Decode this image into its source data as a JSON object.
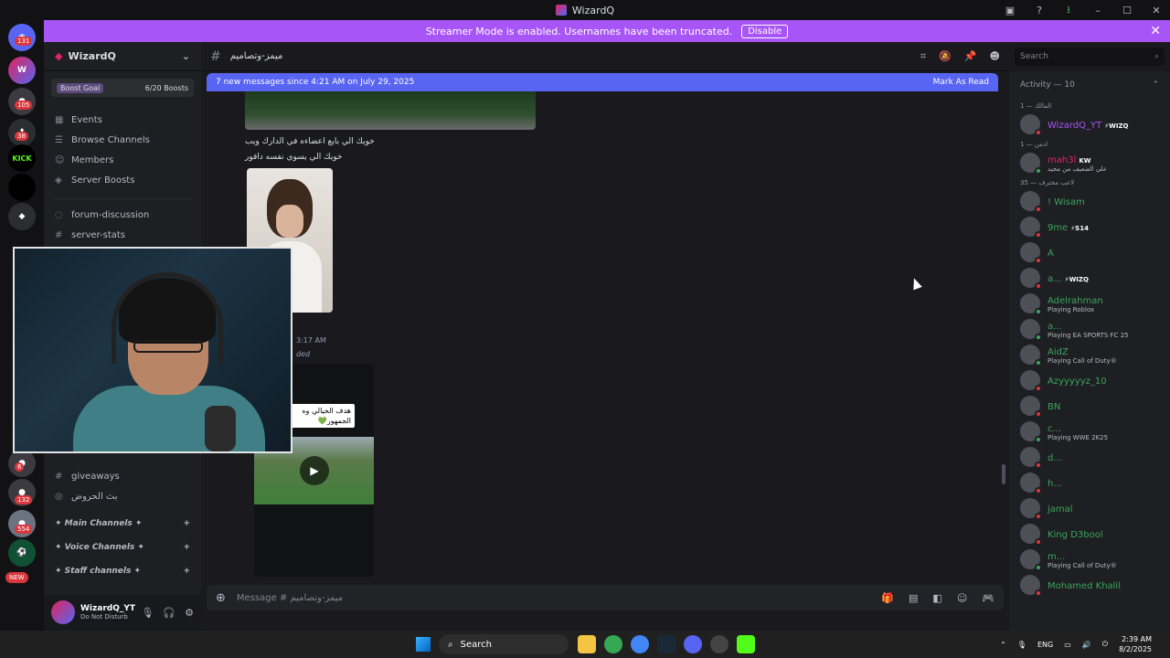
{
  "window": {
    "title": "WizardQ"
  },
  "banner": {
    "text": "Streamer Mode is enabled. Usernames have been truncated.",
    "button": "Disable"
  },
  "servers": {
    "badges": [
      "131",
      "105",
      "38",
      "6",
      "132",
      "554"
    ],
    "kick_label": "KICK",
    "new_label": "NEW"
  },
  "guild": {
    "name": "WizardQ",
    "boost_goal": "Boost Goal",
    "boosts": "6/20 Boosts"
  },
  "nav": {
    "events": "Events",
    "browse": "Browse Channels",
    "members": "Members",
    "boosts": "Server Boosts",
    "forum": "forum-discussion",
    "stats": "server-stats",
    "giveaways": "giveaways",
    "stream": "بث الحروض"
  },
  "categories": [
    "✦ Main Channels ✦",
    "✦ Voice Channels ✦",
    "✦ Staff channels ✦"
  ],
  "user": {
    "name": "WizardQ_YT",
    "status": "Do Not Disturb"
  },
  "channel": {
    "name": "ميمز-وتصاميم"
  },
  "search": {
    "placeholder": "Search"
  },
  "new_messages": {
    "text": "7 new messages since 4:21 AM on July 29, 2025",
    "action": "Mark As Read"
  },
  "chat": {
    "line1": "خويك الي بايع اعضاءه في الدارك ويب",
    "line2": "خويك الي يسوي نفسه دافور",
    "time": "3:17 AM",
    "edited": "ded",
    "video_caption": "هدف الخيالي وه الجمهور💚"
  },
  "composer": {
    "placeholder": "Message # ميمز-وتصاميم"
  },
  "members": {
    "activity": "Activity — 10",
    "groups": [
      "المالك — 1",
      "ادمن — 1",
      "لاعب محترف — 35"
    ],
    "list": [
      {
        "name": "WizardQ_YT",
        "tag": "⚡WIZQ",
        "sub": "",
        "color": "#a855f7"
      },
      {
        "name": "mah3l",
        "tag": "KW",
        "sub": "علي الضعيف من مجيد",
        "color": "#e0245e"
      },
      {
        "name": "! Wisam",
        "tag": "",
        "sub": "",
        "color": "#3ba55d"
      },
      {
        "name": "9me",
        "tag": "⚡S14",
        "sub": "",
        "color": "#3ba55d"
      },
      {
        "name": "A",
        "tag": "",
        "sub": "",
        "color": "#3ba55d"
      },
      {
        "name": "a...",
        "tag": "⚡WIZQ",
        "sub": "",
        "color": "#3ba55d"
      },
      {
        "name": "Adelrahman",
        "tag": "",
        "sub": "Playing Roblox",
        "color": "#3ba55d"
      },
      {
        "name": "a...",
        "tag": "",
        "sub": "Playing EA SPORTS FC 25",
        "color": "#3ba55d"
      },
      {
        "name": "AidZ",
        "tag": "",
        "sub": "Playing Call of Duty®",
        "color": "#3ba55d"
      },
      {
        "name": "Azyyyyyz_10",
        "tag": "",
        "sub": "",
        "color": "#3ba55d"
      },
      {
        "name": "BN",
        "tag": "",
        "sub": "",
        "color": "#3ba55d"
      },
      {
        "name": "c...",
        "tag": "",
        "sub": "Playing WWE 2K25",
        "color": "#3ba55d"
      },
      {
        "name": "d...",
        "tag": "",
        "sub": "",
        "color": "#3ba55d"
      },
      {
        "name": "h...",
        "tag": "",
        "sub": "",
        "color": "#3ba55d"
      },
      {
        "name": "jamal",
        "tag": "",
        "sub": "",
        "color": "#3ba55d"
      },
      {
        "name": "King D3bool",
        "tag": "",
        "sub": "",
        "color": "#3ba55d"
      },
      {
        "name": "m...",
        "tag": "",
        "sub": "Playing Call of Duty®",
        "color": "#3ba55d"
      },
      {
        "name": "Mohamed Khalil",
        "tag": "",
        "sub": "",
        "color": "#3ba55d"
      }
    ]
  },
  "taskbar": {
    "search": "Search",
    "lang": "ENG",
    "time": "2:39 AM",
    "date": "8/2/2025"
  }
}
